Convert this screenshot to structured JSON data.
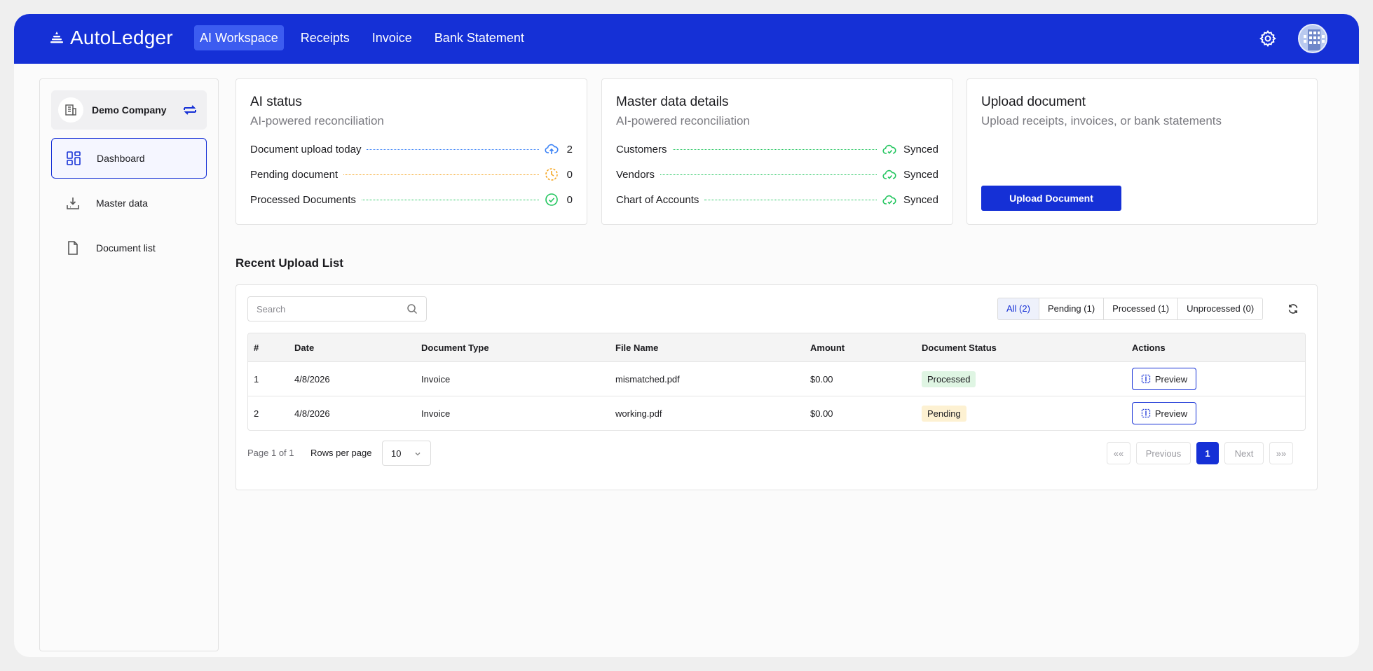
{
  "header": {
    "brand": "AutoLedger",
    "nav": [
      {
        "label": "AI Workspace",
        "active": true
      },
      {
        "label": "Receipts",
        "active": false
      },
      {
        "label": "Invoice",
        "active": false
      },
      {
        "label": "Bank Statement",
        "active": false
      }
    ]
  },
  "sidebar": {
    "company": "Demo Company",
    "items": [
      {
        "label": "Dashboard",
        "icon": "dashboard-icon",
        "active": true
      },
      {
        "label": "Master data",
        "icon": "download-tray-icon",
        "active": false
      },
      {
        "label": "Document list",
        "icon": "document-icon",
        "active": false
      }
    ]
  },
  "ai_status": {
    "title": "AI status",
    "subtitle": "AI-powered reconciliation",
    "rows": [
      {
        "label": "Document upload today",
        "value": "2",
        "icon": "cloud-upload-icon",
        "color": "#3b82f6"
      },
      {
        "label": "Pending document",
        "value": "0",
        "icon": "clock-icon",
        "color": "#f5a623"
      },
      {
        "label": "Processed Documents",
        "value": "0",
        "icon": "check-circle-icon",
        "color": "#22c55e"
      }
    ]
  },
  "master_data": {
    "title": "Master data details",
    "subtitle": "AI-powered reconciliation",
    "rows": [
      {
        "label": "Customers",
        "value": "Synced",
        "icon": "cloud-check-icon",
        "color": "#22c55e"
      },
      {
        "label": "Vendors",
        "value": "Synced",
        "icon": "cloud-check-icon",
        "color": "#22c55e"
      },
      {
        "label": "Chart of Accounts",
        "value": "Synced",
        "icon": "cloud-check-icon",
        "color": "#22c55e"
      }
    ]
  },
  "upload": {
    "title": "Upload document",
    "subtitle": "Upload receipts, invoices, or bank statements",
    "button": "Upload Document"
  },
  "recent": {
    "title": "Recent Upload List",
    "search_placeholder": "Search",
    "filters": [
      {
        "label": "All (2)",
        "active": true
      },
      {
        "label": "Pending (1)",
        "active": false
      },
      {
        "label": "Processed (1)",
        "active": false
      },
      {
        "label": "Unprocessed (0)",
        "active": false
      }
    ],
    "columns": [
      "#",
      "Date",
      "Document Type",
      "File Name",
      "Amount",
      "Document Status",
      "Actions"
    ],
    "rows": [
      {
        "num": "1",
        "date": "4/8/2026",
        "type": "Invoice",
        "file": "mismatched.pdf",
        "amount": "$0.00",
        "status": "Processed",
        "action": "Preview"
      },
      {
        "num": "2",
        "date": "4/8/2026",
        "type": "Invoice",
        "file": "working.pdf",
        "amount": "$0.00",
        "status": "Pending",
        "action": "Preview"
      }
    ],
    "pager": {
      "info": "Page 1 of 1",
      "rows_label": "Rows per page",
      "rows_value": "10",
      "first": "««",
      "previous": "Previous",
      "current": "1",
      "next": "Next",
      "last": "»»"
    }
  },
  "colors": {
    "primary": "#1530d6",
    "nav_active": "#3c5cf0"
  }
}
